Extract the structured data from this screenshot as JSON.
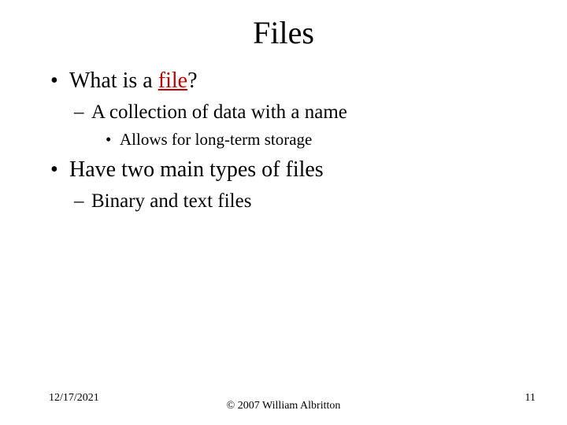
{
  "title": "Files",
  "bullets": {
    "b1_prefix": "What is a ",
    "b1_highlight": "file",
    "b1_suffix": "?",
    "b1_1": "A collection of data with a name",
    "b1_1_1": "Allows for long-term storage",
    "b2": "Have two main types of files",
    "b2_1": "Binary and text files"
  },
  "footer": {
    "date": "12/17/2021",
    "copyright": "© 2007 William Albritton",
    "page": "11"
  }
}
